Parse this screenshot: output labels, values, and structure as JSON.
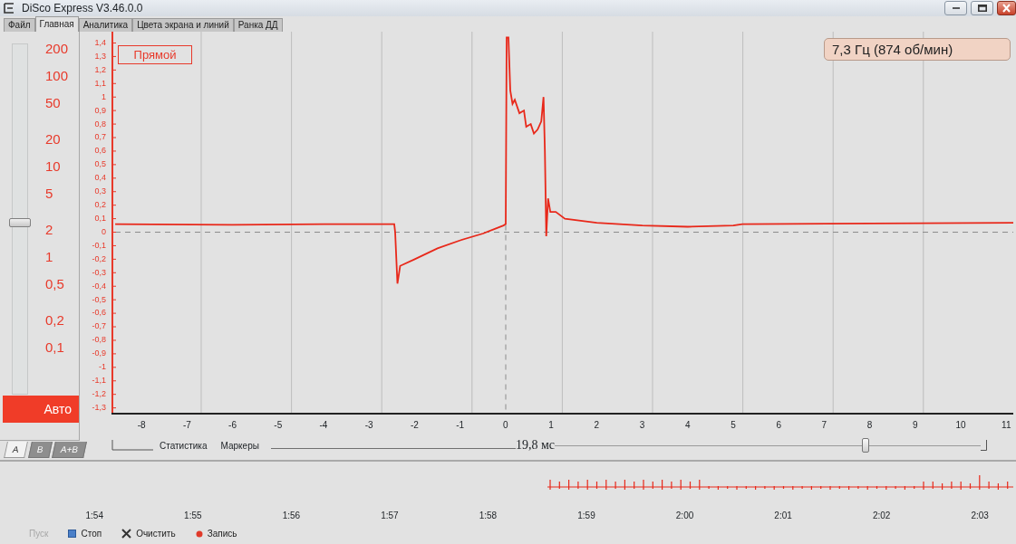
{
  "window": {
    "title": "DiSco Express V3.46.0.0"
  },
  "menu_tabs": [
    {
      "label": "Файл",
      "selected": false
    },
    {
      "label": "Главная",
      "selected": true
    },
    {
      "label": "Аналитика",
      "selected": false
    },
    {
      "label": "Цвета экрана и линий",
      "selected": false
    },
    {
      "label": "Ранка ДД",
      "selected": false
    }
  ],
  "gain_scale": {
    "labels": [
      "200",
      "100",
      "50",
      "20",
      "10",
      "5",
      "2",
      "1",
      "0,5",
      "0,2",
      "0,1"
    ],
    "auto": {
      "label": "Авто",
      "on": true
    },
    "level": 0.49
  },
  "channel_tabs": [
    {
      "label": "A",
      "selected": true
    },
    {
      "label": "B",
      "selected": false
    },
    {
      "label": "A+B",
      "selected": false
    }
  ],
  "scope": {
    "mode": "Прямой",
    "frequency": "7,3 Гц (874 об/мин)",
    "y_ticks": [
      "1,4",
      "1,3",
      "1,2",
      "1,1",
      "1",
      "0,9",
      "0,8",
      "0,7",
      "0,6",
      "0,5",
      "0,4",
      "0,3",
      "0,2",
      "0,1",
      "0",
      "-0,1",
      "-0,2",
      "-0,3",
      "-0,4",
      "-0,5",
      "-0,6",
      "-0,7",
      "-0,8",
      "-0,9",
      "-1",
      "-1,1",
      "-1,2",
      "-1,3"
    ],
    "x_ticks": [
      "-8",
      "-7",
      "-6",
      "-5",
      "-4",
      "-3",
      "-2",
      "-1",
      "0",
      "1",
      "2",
      "3",
      "4",
      "5",
      "6",
      "7",
      "8",
      "9",
      "10",
      "11"
    ]
  },
  "controls": {
    "statistics": "Статистика",
    "markers": "Маркеры",
    "time_scale": "19,8 мс",
    "level": 0.73
  },
  "timeline": {
    "labels": [
      "1:54",
      "1:55",
      "1:56",
      "1:57",
      "1:58",
      "1:59",
      "2:00",
      "2:01",
      "2:02",
      "2:03"
    ]
  },
  "toolbar": [
    {
      "label": "Пуск",
      "kind": "start",
      "disabled": true
    },
    {
      "label": "Стоп",
      "kind": "stop",
      "disabled": false
    },
    {
      "label": "Очистить",
      "kind": "clear",
      "disabled": false
    },
    {
      "label": "Запись",
      "kind": "record",
      "disabled": false
    }
  ]
}
